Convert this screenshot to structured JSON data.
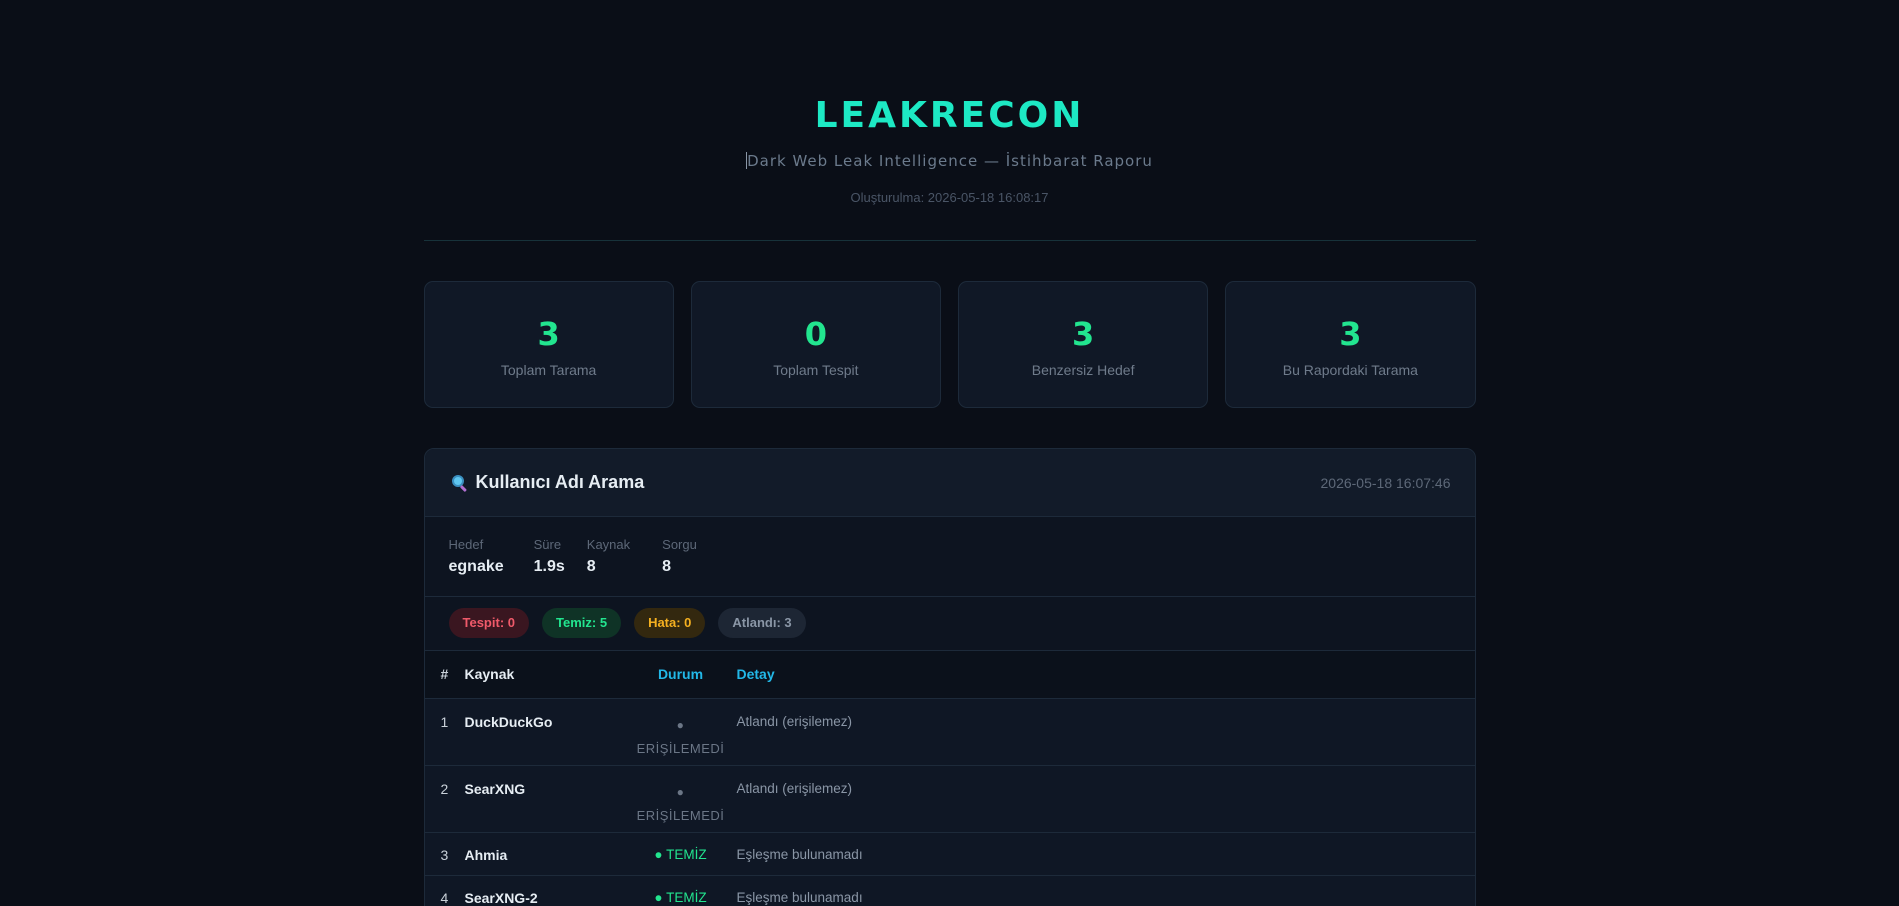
{
  "header": {
    "logo": "LEAKRECON",
    "subtitle": "Dark Web Leak Intelligence — İstihbarat Raporu",
    "generated": "Oluşturulma: 2026-05-18 16:08:17"
  },
  "stats": [
    {
      "value": "3",
      "label": "Toplam Tarama"
    },
    {
      "value": "0",
      "label": "Toplam Tespit"
    },
    {
      "value": "3",
      "label": "Benzersiz Hedef"
    },
    {
      "value": "3",
      "label": "Bu Rapordaki Tarama"
    }
  ],
  "scan": {
    "title": "Kullanıcı Adı Arama",
    "icon": "magnifier-icon",
    "date": "2026-05-18 16:07:46",
    "meta": [
      {
        "label": "Hedef",
        "value": "egnake"
      },
      {
        "label": "Süre",
        "value": "1.9s"
      },
      {
        "label": "Kaynak",
        "value": "8"
      },
      {
        "label": "Sorgu",
        "value": "8"
      }
    ],
    "badges": [
      {
        "text": "Tespit: 0",
        "color": "#f05a6a"
      },
      {
        "text": "Temiz: 5",
        "color": "#22e58f"
      },
      {
        "text": "Hata: 0",
        "color": "#f5b020"
      },
      {
        "text": "Atlandı: 3",
        "color": "#8a96a6"
      }
    ],
    "table": {
      "headers": [
        "#",
        "Kaynak",
        "Durum",
        "Detay"
      ],
      "rows": [
        {
          "num": "1",
          "source": "DuckDuckGo",
          "dot": "●",
          "status": "ERİŞİLEMEDİ",
          "detail": "Atlandı (erişilemez)"
        },
        {
          "num": "2",
          "source": "SearXNG",
          "dot": "●",
          "status": "ERİŞİLEMEDİ",
          "detail": "Atlandı (erişilemez)"
        },
        {
          "num": "3",
          "source": "Ahmia",
          "status": "● TEMİZ",
          "detail": "Eşleşme bulunamadı"
        },
        {
          "num": "4",
          "source": "SearXNG-2",
          "status": "● TEMİZ",
          "detail": "Eşleşme bulunamadı"
        }
      ]
    }
  }
}
